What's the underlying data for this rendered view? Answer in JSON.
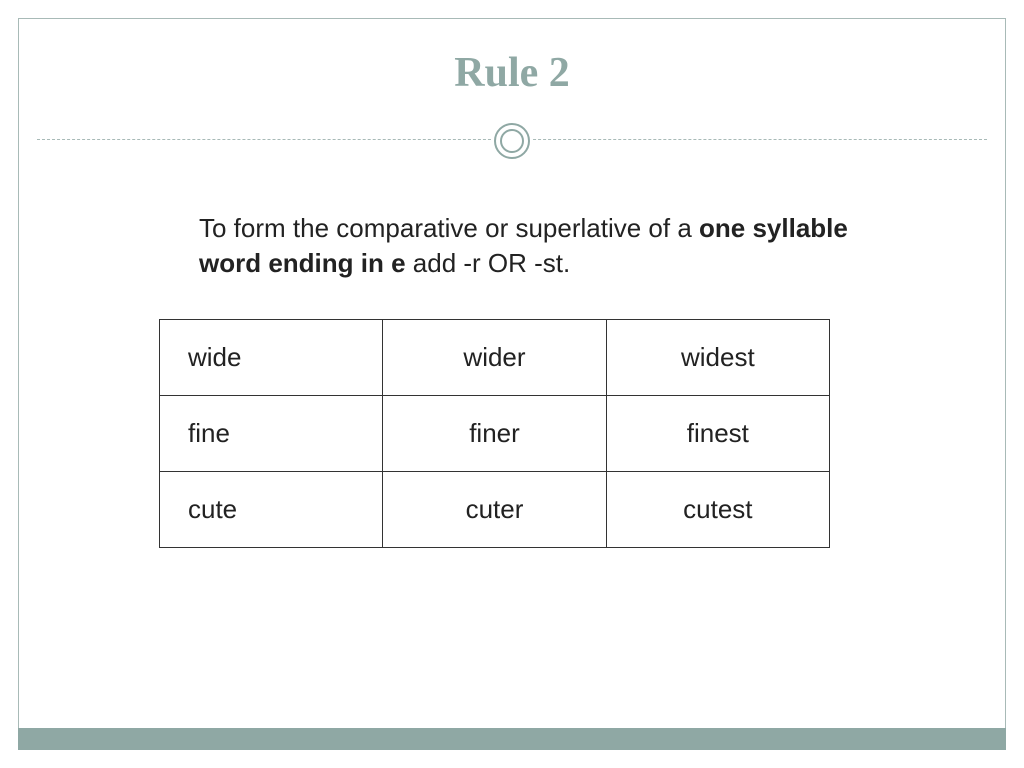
{
  "title": "Rule 2",
  "description": {
    "part1": "To form the comparative or superlative of a ",
    "bold": "one syllable word ending in e",
    "part2": " add -r OR -st."
  },
  "table": {
    "rows": [
      {
        "base": "wide",
        "comparative": "wider",
        "superlative": "widest"
      },
      {
        "base": "fine",
        "comparative": "finer",
        "superlative": "finest"
      },
      {
        "base": "cute",
        "comparative": "cuter",
        "superlative": "cutest"
      }
    ]
  }
}
